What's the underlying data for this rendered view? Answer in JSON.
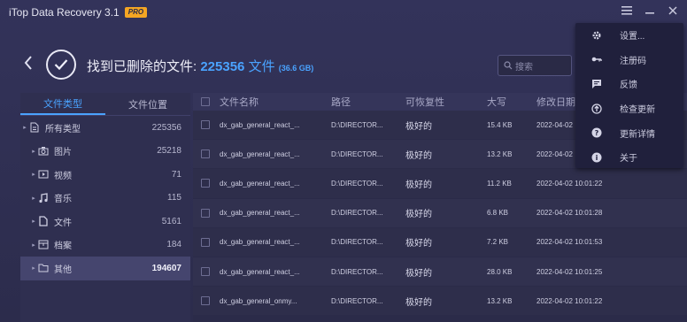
{
  "app": {
    "title": "iTop Data Recovery 3.1",
    "badge": "PRO"
  },
  "header": {
    "title": "找到已删除的文件:",
    "count": "225356",
    "unit": "文件",
    "size": "(36.6 GB)"
  },
  "search": {
    "placeholder": "搜索"
  },
  "sidebar": {
    "tabs": [
      {
        "label": "文件类型",
        "active": true
      },
      {
        "label": "文件位置",
        "active": false
      }
    ],
    "items": [
      {
        "label": "所有类型",
        "count": "225356",
        "icon": "document-icon"
      },
      {
        "label": "图片",
        "count": "25218",
        "icon": "camera-icon"
      },
      {
        "label": "视频",
        "count": "71",
        "icon": "video-icon"
      },
      {
        "label": "音乐",
        "count": "115",
        "icon": "music-icon"
      },
      {
        "label": "文件",
        "count": "5161",
        "icon": "file-icon"
      },
      {
        "label": "档案",
        "count": "184",
        "icon": "archive-icon"
      },
      {
        "label": "其他",
        "count": "194607",
        "icon": "folder-icon"
      }
    ]
  },
  "table": {
    "columns": [
      "文件名称",
      "路径",
      "可恢复性",
      "大写",
      "修改日期"
    ],
    "rows": [
      {
        "name": "dx_gab_general_react_...",
        "path": "D:\\DIRECTOR...",
        "recover": "极好的",
        "size": "15.4 KB",
        "date": "2022-04-02"
      },
      {
        "name": "dx_gab_general_react_...",
        "path": "D:\\DIRECTOR...",
        "recover": "极好的",
        "size": "13.2 KB",
        "date": "2022-04-02"
      },
      {
        "name": "dx_gab_general_react_...",
        "path": "D:\\DIRECTOR...",
        "recover": "极好的",
        "size": "11.2 KB",
        "date": "2022-04-02 10:01:22"
      },
      {
        "name": "dx_gab_general_react_...",
        "path": "D:\\DIRECTOR...",
        "recover": "极好的",
        "size": "6.8 KB",
        "date": "2022-04-02 10:01:28"
      },
      {
        "name": "dx_gab_general_react_...",
        "path": "D:\\DIRECTOR...",
        "recover": "极好的",
        "size": "7.2 KB",
        "date": "2022-04-02 10:01:53"
      },
      {
        "name": "dx_gab_general_react_...",
        "path": "D:\\DIRECTOR...",
        "recover": "极好的",
        "size": "28.0 KB",
        "date": "2022-04-02 10:01:25"
      },
      {
        "name": "dx_gab_general_onmy...",
        "path": "D:\\DIRECTOR...",
        "recover": "极好的",
        "size": "13.2 KB",
        "date": "2022-04-02 10:01:22"
      }
    ]
  },
  "menu": {
    "items": [
      {
        "label": "设置...",
        "icon": "gear-icon"
      },
      {
        "label": "注册码",
        "icon": "key-icon"
      },
      {
        "label": "反馈",
        "icon": "feedback-icon"
      },
      {
        "label": "检查更新",
        "icon": "update-icon"
      },
      {
        "label": "更新详情",
        "icon": "help-icon"
      },
      {
        "label": "关于",
        "icon": "info-icon"
      }
    ]
  },
  "colors": {
    "accent": "#4aa3ff",
    "badge": "#f5a623",
    "background": "#2c2c4c"
  }
}
